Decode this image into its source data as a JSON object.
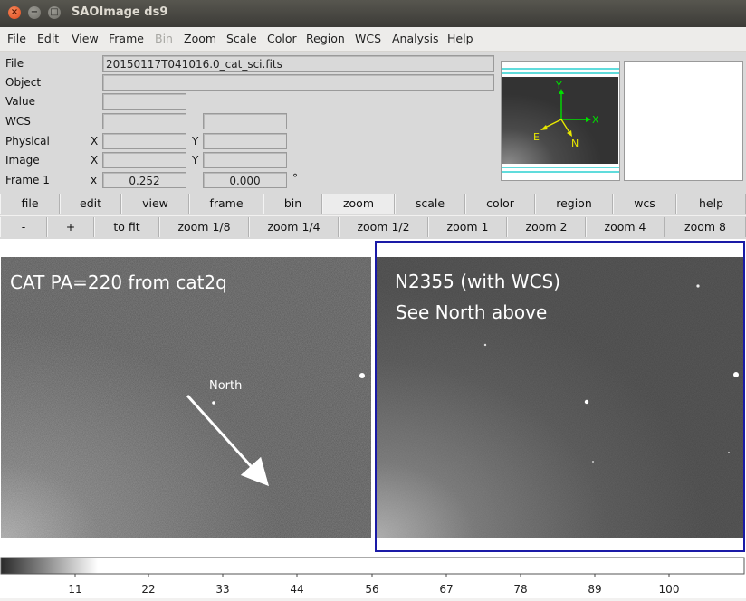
{
  "window": {
    "title": "SAOImage ds9",
    "close_glyph": "×",
    "minimize_glyph": "−",
    "maximize_glyph": "□"
  },
  "menubar": {
    "items": [
      "File",
      "Edit",
      "View",
      "Frame",
      "Bin",
      "Zoom",
      "Scale",
      "Color",
      "Region",
      "WCS",
      "Analysis",
      "Help"
    ],
    "disabled": [
      "Bin"
    ]
  },
  "info": {
    "file_label": "File",
    "file_value": "20150117T041016.0_cat_sci.fits",
    "object_label": "Object",
    "object_value": "",
    "value_label": "Value",
    "value_value": "",
    "wcs_label": "WCS",
    "physical_label": "Physical",
    "image_label": "Image",
    "frame_label": "Frame 1",
    "x_label": "X",
    "y_label": "Y",
    "frame_x_label": "x",
    "frame_val1": "0.252",
    "frame_val2": "0.000",
    "degree_symbol": "°"
  },
  "panner": {
    "compass": {
      "n": "N",
      "e": "E",
      "x": "X",
      "y": "Y"
    }
  },
  "buttonbar": {
    "row1": [
      "file",
      "edit",
      "view",
      "frame",
      "bin",
      "zoom",
      "scale",
      "color",
      "region",
      "wcs",
      "help"
    ],
    "row1_active": "zoom",
    "row2": [
      "-",
      "+",
      "to fit",
      "zoom 1/8",
      "zoom 1/4",
      "zoom 1/2",
      "zoom 1",
      "zoom 2",
      "zoom 4",
      "zoom 8"
    ]
  },
  "frames": {
    "left": {
      "title": "CAT PA=220 from cat2q",
      "arrow_label": "North"
    },
    "right": {
      "title": "N2355 (with WCS)",
      "subtitle": "See North above",
      "highlight_color": "#1a1aa6"
    }
  },
  "colorbar": {
    "ticks": [
      "11",
      "22",
      "33",
      "44",
      "56",
      "67",
      "78",
      "89",
      "100"
    ]
  },
  "colors": {
    "compass_ne": "#e8e800",
    "compass_xy": "#00e000",
    "panner_lines": "#00c8c8",
    "annotation": "#ffffff"
  }
}
